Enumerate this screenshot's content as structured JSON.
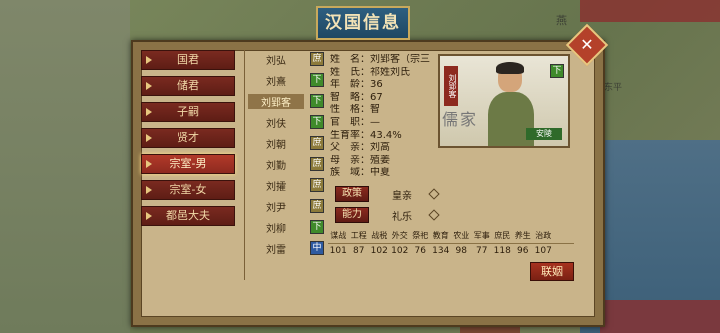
{
  "window": {
    "title": "汉国信息",
    "close_icon": "close-x-icon"
  },
  "map": {
    "labels": [
      "燕",
      "东平"
    ]
  },
  "categories": [
    {
      "label": "国君",
      "active": false
    },
    {
      "label": "储君",
      "active": false
    },
    {
      "label": "子嗣",
      "active": false
    },
    {
      "label": "贤才",
      "active": false
    },
    {
      "label": "宗室-男",
      "active": true
    },
    {
      "label": "宗室-女",
      "active": false
    },
    {
      "label": "都邑大夫",
      "active": false
    }
  ],
  "members": [
    {
      "name": "刘弘",
      "tag": "庶"
    },
    {
      "name": "刘熹",
      "tag": "下"
    },
    {
      "name": "刘郢客",
      "tag": "下"
    },
    {
      "name": "刘伕",
      "tag": "下"
    },
    {
      "name": "刘朝",
      "tag": "庶"
    },
    {
      "name": "刘勤",
      "tag": "庶"
    },
    {
      "name": "刘攉",
      "tag": "庶"
    },
    {
      "name": "刘尹",
      "tag": "庶"
    },
    {
      "name": "刘柳",
      "tag": "下"
    },
    {
      "name": "刘雷",
      "tag": "中"
    }
  ],
  "selected_index": 2,
  "info": [
    "姓　名：刘郢客（宗三",
    "姓　氏：祁姓刘氏",
    "年　龄：36",
    "智　略：67",
    "性　格：智",
    "官　职：—",
    "生育率：43.4%",
    "父　亲：刘高",
    "母　亲：殖姜",
    "族　域：中夏"
  ],
  "portrait": {
    "vertical_label": "刘郢客",
    "bg_text": "儒家",
    "rank_tag": "下",
    "seal": "安陵"
  },
  "actions": [
    {
      "label": "政策",
      "value": "皇亲"
    },
    {
      "label": "能力",
      "value": "礼乐"
    }
  ],
  "stats": {
    "headers": [
      "谋战",
      "工程",
      "战税",
      "外交",
      "祭祀",
      "教育",
      "农业",
      "军事",
      "庶民",
      "养生",
      "治政"
    ],
    "values": [
      "101",
      "87",
      "102",
      "102",
      "76",
      "134",
      "98",
      "77",
      "118",
      "96",
      "107"
    ]
  },
  "marry_button": "联姻"
}
